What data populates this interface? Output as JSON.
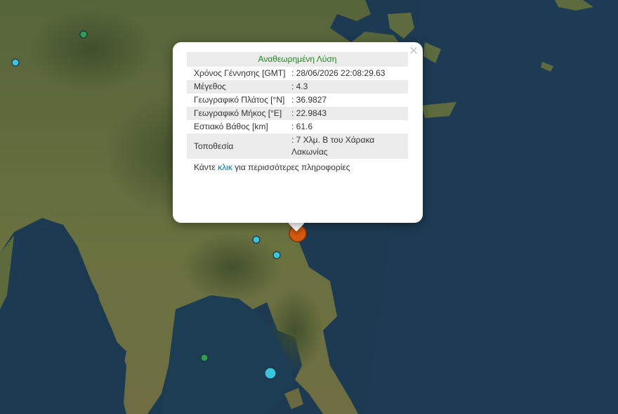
{
  "popup": {
    "title": "Αναθεωρημένη Λύση",
    "rows": [
      {
        "label": "Χρόνος Γέννησης [GMT]",
        "value": ": 28/06/2026 22:08:29.63"
      },
      {
        "label": "Μέγεθος",
        "value": ": 4.3"
      },
      {
        "label": "Γεωγραφικό Πλάτος [°N]",
        "value": ": 36.9827"
      },
      {
        "label": "Γεωγραφικό Μήκος [°E]",
        "value": ": 22.9843"
      },
      {
        "label": "Εστιακό Βάθος [km]",
        "value": ": 61.6"
      },
      {
        "label": "Τοποθεσία",
        "value": ": 7 Χλμ. Β του Χάρακα Λακωνίας"
      }
    ],
    "more_prefix": "Κάντε ",
    "more_link": "κλικ",
    "more_suffix": " για περισσότερες πληροφορίες",
    "close_symbol": "×"
  },
  "colors": {
    "sea": "#1c3a52",
    "land": "#5d6a3e",
    "marker_selected": "#d55a10",
    "marker_cyan": "#3cc4dc",
    "marker_green": "#2f9e4f",
    "title_green": "#1a8a1a"
  },
  "icons": [
    "close-icon"
  ]
}
